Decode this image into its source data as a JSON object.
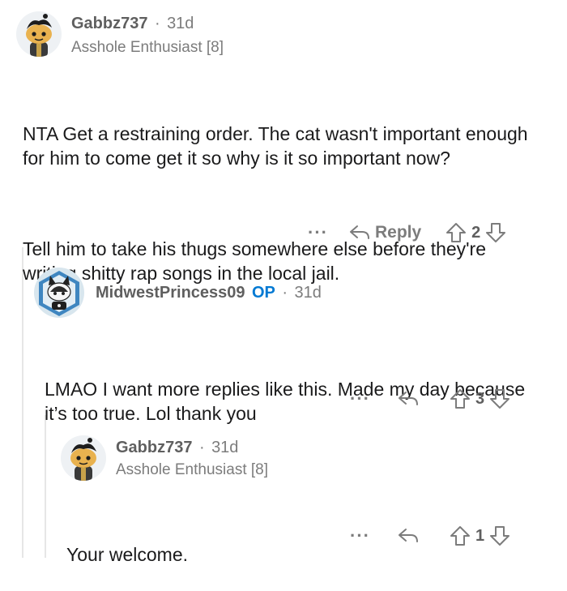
{
  "comments": [
    {
      "username": "Gabbz737",
      "separator": "·",
      "time": "31d",
      "flair": "Asshole Enthusiast [8]",
      "paragraphs": [
        "NTA Get a restraining order. The cat wasn't important enough for him to come get it so why is it so important now?",
        "Tell him to take his thugs somewhere else before they're writing shitty rap songs in the local jail."
      ],
      "more": "···",
      "reply_label": "Reply",
      "votes": "2"
    },
    {
      "username": "MidwestPrincess09",
      "op_badge": "OP",
      "separator": "·",
      "time": "31d",
      "paragraphs": [
        "LMAO I want more replies like this. Made my day because it’s too true. Lol thank you"
      ],
      "more": "···",
      "votes": "3"
    },
    {
      "username": "Gabbz737",
      "separator": "·",
      "time": "31d",
      "flair": "Asshole Enthusiast [8]",
      "paragraphs": [
        "Your welcome."
      ],
      "more": "···",
      "votes": "1"
    }
  ],
  "colors": {
    "text": "#1a1a1b",
    "muted": "#7c7c7c",
    "op_blue": "#0079d3",
    "thread_line": "#e6e6e6"
  }
}
